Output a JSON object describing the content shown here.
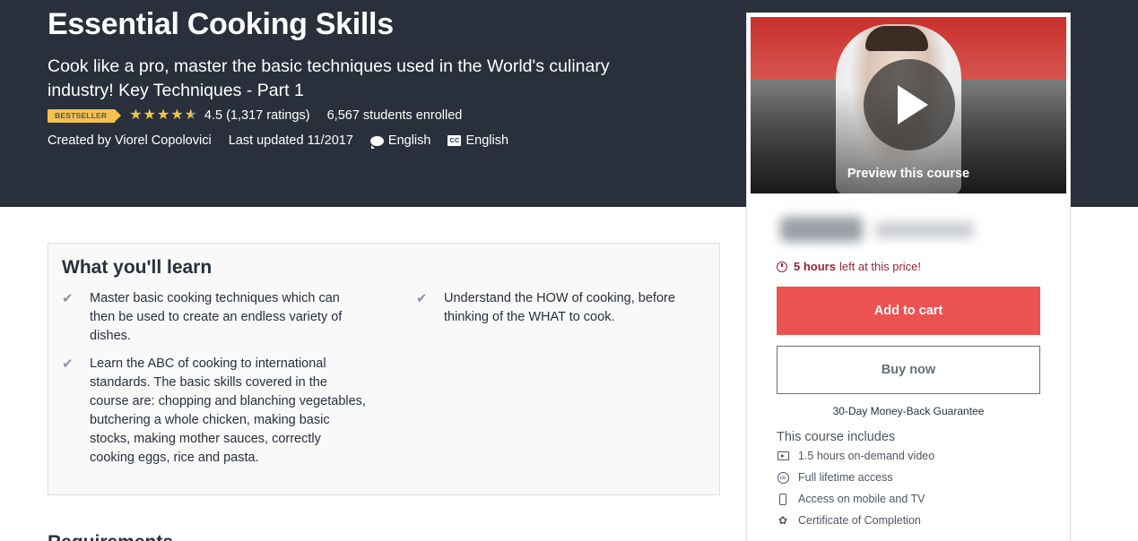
{
  "course": {
    "title": "Essential Cooking Skills",
    "subtitle": "Cook like a pro, master the basic techniques used in the World's culinary industry! Key Techniques - Part 1",
    "badge": "BESTSELLER",
    "rating": 4.5,
    "rating_text": "4.5 (1,317 ratings)",
    "students_text": "6,567 students enrolled",
    "created_by": "Created by Viorel Copolovici",
    "last_updated": "Last updated 11/2017",
    "language": "English",
    "captions": "English",
    "captions_icon_text": "CC"
  },
  "learn": {
    "heading": "What you'll learn",
    "items": [
      "Master basic cooking techniques which can then be used to create an endless variety of dishes.",
      "Understand the HOW of cooking, before thinking of the WHAT to cook.",
      "Learn the ABC of cooking to international standards. The basic skills covered in the course are: chopping and blanching vegetables, butchering a whole chicken, making basic stocks, making mother sauces, correctly cooking eggs, rice and pasta."
    ],
    "next_heading": "Requirements"
  },
  "sidebar": {
    "preview_label": "Preview this course",
    "timer_bold": "5 hours",
    "timer_rest": "left at this price!",
    "add_to_cart": "Add to cart",
    "buy_now": "Buy now",
    "guarantee": "30-Day Money-Back Guarantee",
    "includes_heading": "This course includes",
    "includes": [
      {
        "icon": "video-icon",
        "text": "1.5 hours on-demand video"
      },
      {
        "icon": "infinity-icon",
        "text": "Full lifetime access"
      },
      {
        "icon": "mobile-icon",
        "text": "Access on mobile and TV"
      },
      {
        "icon": "certificate-icon",
        "text": "Certificate of Completion"
      }
    ]
  },
  "colors": {
    "hero_bg": "#29303b",
    "accent_red": "#ec5252",
    "badge_yellow": "#f4c150",
    "timer_red": "#992337"
  }
}
